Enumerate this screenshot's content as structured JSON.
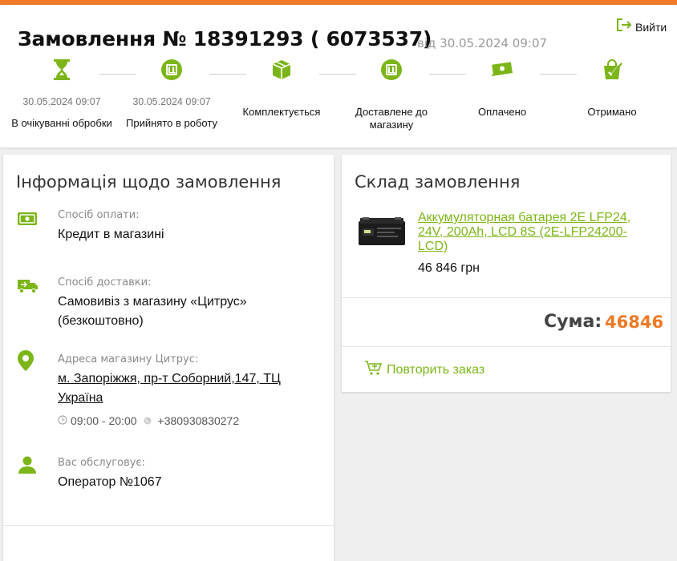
{
  "header": {
    "title": "Замовлення № 18391293 ( 6073537)",
    "date": "від 30.05.2024 09:07",
    "logout_label": "Вийти"
  },
  "steps": [
    {
      "icon": "hourglass-icon",
      "date": "30.05.2024 09:07",
      "label": "В очікуванні обробки"
    },
    {
      "icon": "order-c-icon",
      "date": "30.05.2024 09:07",
      "label": "Прийнято в роботу"
    },
    {
      "icon": "package-icon",
      "date": "",
      "label": "Комплектується"
    },
    {
      "icon": "store-c-icon",
      "date": "",
      "label": "Доставлене до магазину"
    },
    {
      "icon": "money-icon",
      "date": "",
      "label": "Оплачено"
    },
    {
      "icon": "received-bag-icon",
      "date": "",
      "label": "Отримано"
    }
  ],
  "info": {
    "title": "Інформація щодо замовлення",
    "payment_label": "Спосіб оплати:",
    "payment_value": "Кредит в магазині",
    "delivery_label": "Спосіб доставки:",
    "delivery_value": "Самовивіз з магазину «Цитрус» (безкоштовно)",
    "address_label": "Адреса магазину Цитрус:",
    "address_value": "м. Запоріжжя, пр-т Соборний,147, ТЦ Україна",
    "hours": "09:00 - 20:00",
    "phone": "+380930830272",
    "operator_label": "Вас обслуговує:",
    "operator_value": "Оператор №1067"
  },
  "order": {
    "title": "Склад замовлення",
    "product_name": "Аккумуляторная батарея 2E LFP24, 24V, 200Ah, LCD 8S (2E-LFP24200-LCD)",
    "product_price": "46 846 грн",
    "sum_label": "Сума:",
    "sum_value": "46846",
    "repeat_label": "Повторить заказ"
  },
  "colors": {
    "accent_green": "#7cb518",
    "accent_orange": "#ee7a25",
    "top_bar": "#f07a2a"
  }
}
